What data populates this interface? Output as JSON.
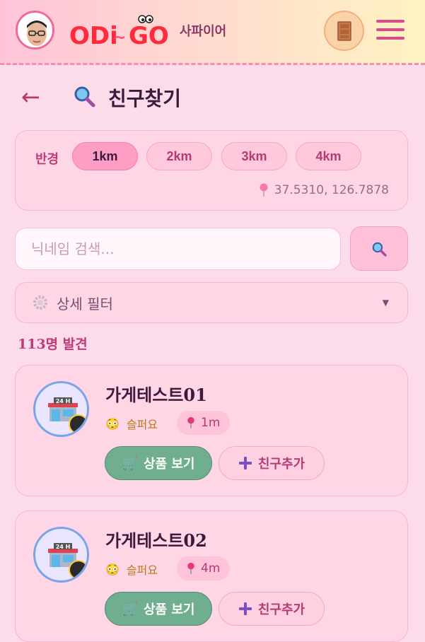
{
  "header": {
    "logo_text": "ODi~GO",
    "title": "사파이어"
  },
  "page": {
    "title": "친구찾기"
  },
  "radius": {
    "label": "반경",
    "options": [
      "1km",
      "2km",
      "3km",
      "4km"
    ],
    "selected": "1km",
    "coordinates": "37.5310, 126.7878"
  },
  "search": {
    "placeholder": "닉네임 검색..."
  },
  "filter": {
    "label": "상세 필터"
  },
  "results": {
    "count_text": "113명 발견"
  },
  "cards": [
    {
      "name": "가게테스트01",
      "mood": "슬퍼요",
      "distance": "1m",
      "product_button": "상품 보기",
      "friend_button": "친구추가"
    },
    {
      "name": "가게테스트02",
      "mood": "슬퍼요",
      "distance": "4m",
      "product_button": "상품 보기",
      "friend_button": "친구추가"
    }
  ],
  "colors": {
    "accent": "#c03a78",
    "background": "#fcdcea",
    "product_button": "#6fae8f"
  },
  "icons": {
    "back": "arrow-left-icon",
    "search": "magnifier-icon",
    "pin": "location-pin-icon",
    "gear": "gear-icon",
    "menu": "hamburger-icon",
    "door": "door-icon"
  }
}
